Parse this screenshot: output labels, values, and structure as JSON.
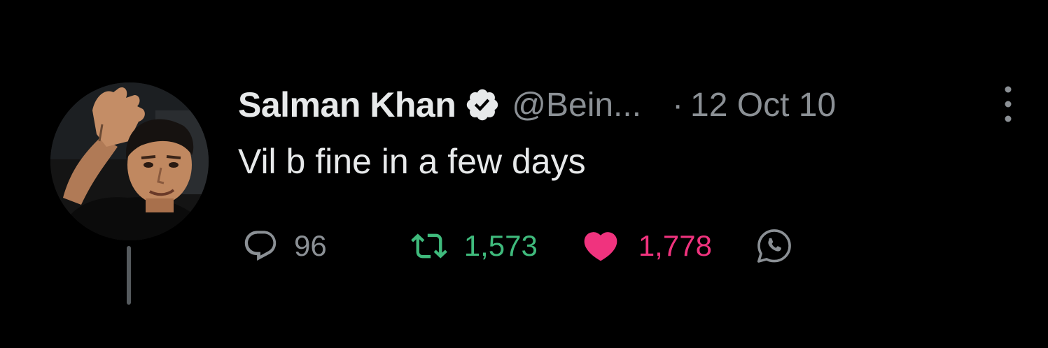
{
  "tweet": {
    "author_name": "Salman Khan",
    "handle": "@Bein...",
    "separator": "·",
    "date": "12 Oct 10",
    "text": "Vil b fine in a few days",
    "verified": true,
    "avatar_icon": "profile-photo",
    "more_icon": "more-vertical-icon"
  },
  "actions": {
    "reply": {
      "icon": "reply-bubble-icon",
      "count": "96"
    },
    "retweet": {
      "icon": "retweet-icon",
      "count": "1,573",
      "active": true
    },
    "like": {
      "icon": "heart-icon",
      "count": "1,778",
      "active": true
    },
    "share": {
      "icon": "whatsapp-icon"
    }
  },
  "colors": {
    "background": "#000000",
    "text": "#e7e9ea",
    "secondary_text": "#8b9095",
    "retweet_active": "#3fba7c",
    "like_active": "#f0337e"
  }
}
